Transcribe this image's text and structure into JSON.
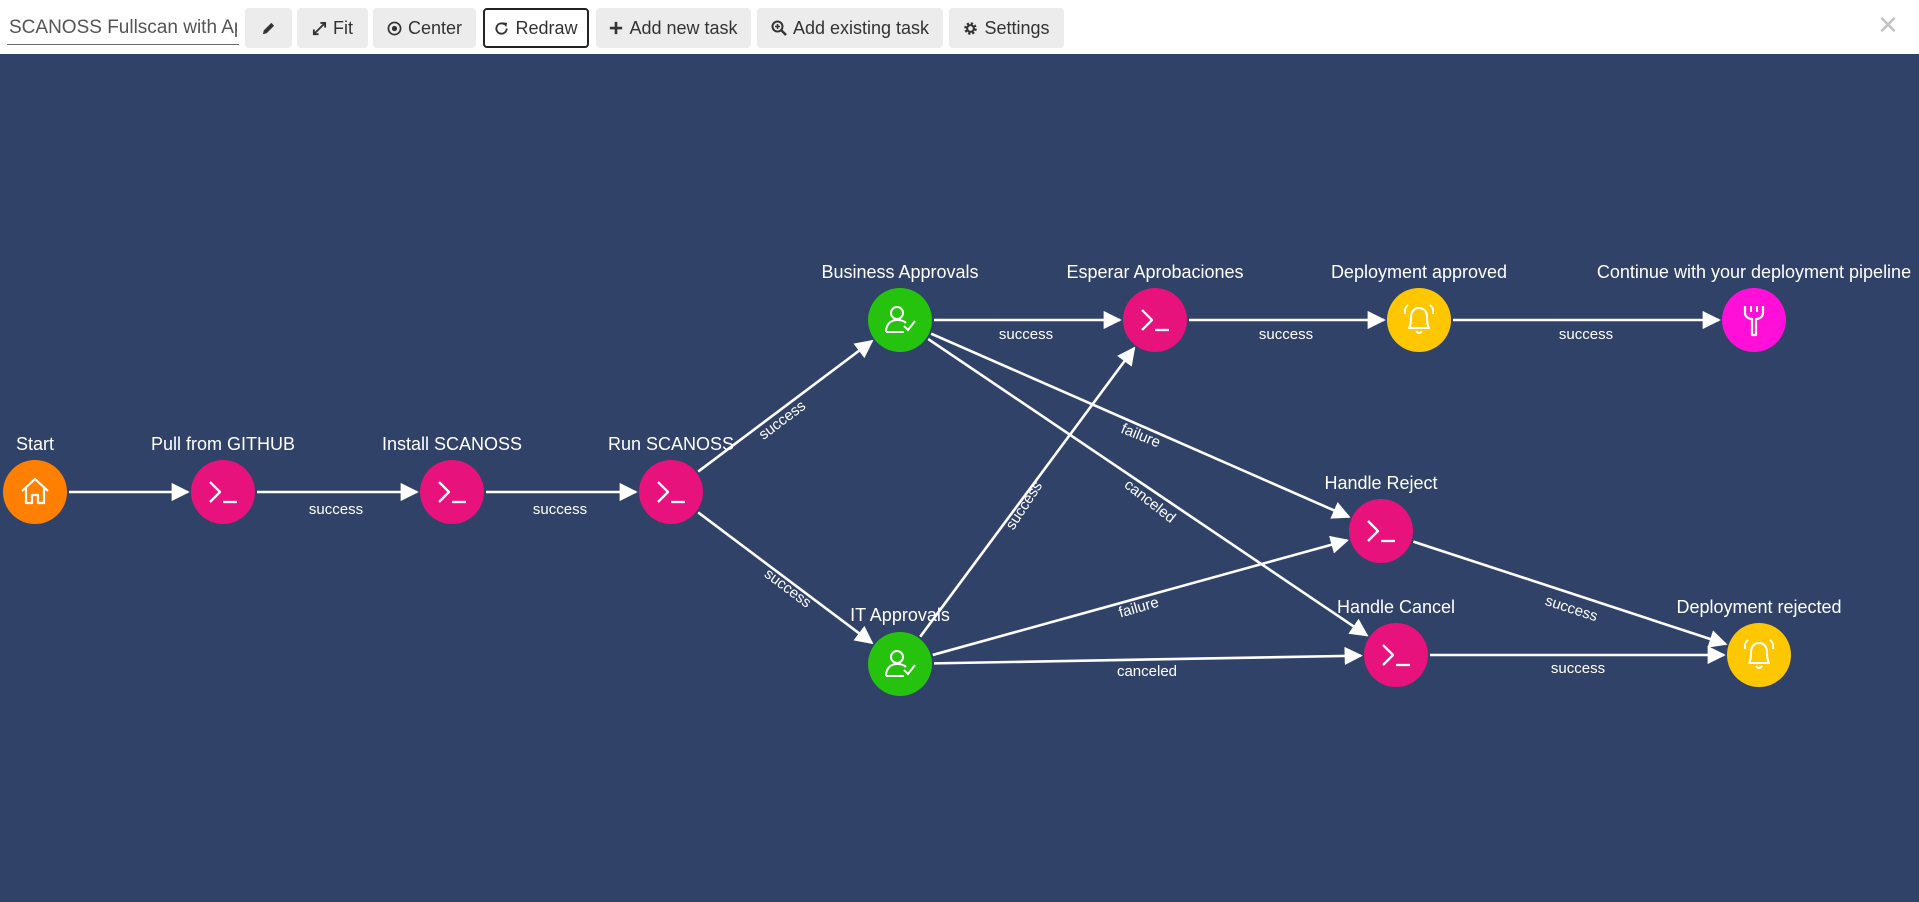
{
  "toolbar": {
    "title_value": "SCANOSS Fullscan with Approvals",
    "buttons": [
      {
        "label": "",
        "icon": "pencil-icon"
      },
      {
        "label": "Fit",
        "icon": "expand-icon"
      },
      {
        "label": "Center",
        "icon": "target-icon"
      },
      {
        "label": "Redraw",
        "icon": "redraw-icon"
      },
      {
        "label": "Add new task",
        "icon": "plus-icon"
      },
      {
        "label": "Add existing task",
        "icon": "search-plus-icon"
      },
      {
        "label": "Settings",
        "icon": "gear-icon"
      }
    ],
    "close_icon": "close-icon"
  },
  "colors": {
    "canvas": "#314269",
    "start": "#ff8000",
    "task": "#e8127c",
    "approval": "#25c20e",
    "notification": "#ffc700",
    "pipeline": "#ff0fd8",
    "edge": "#ffffff"
  },
  "nodes": [
    {
      "id": "start",
      "title": "Start",
      "kind": "start",
      "icon": "home-icon"
    },
    {
      "id": "pull",
      "title": "Pull from GITHUB",
      "kind": "task",
      "icon": "terminal-icon"
    },
    {
      "id": "install",
      "title": "Install SCANOSS",
      "kind": "task",
      "icon": "terminal-icon"
    },
    {
      "id": "run",
      "title": "Run SCANOSS",
      "kind": "task",
      "icon": "terminal-icon"
    },
    {
      "id": "biz",
      "title": "Business Approvals",
      "kind": "approval",
      "icon": "user-check-icon"
    },
    {
      "id": "it",
      "title": "IT Approvals",
      "kind": "approval",
      "icon": "user-check-icon"
    },
    {
      "id": "esperar",
      "title": "Esperar Aprobaciones",
      "kind": "task",
      "icon": "terminal-icon"
    },
    {
      "id": "deployok",
      "title": "Deployment approved",
      "kind": "notification",
      "icon": "bell-icon"
    },
    {
      "id": "continue",
      "title": "Continue with your deployment pipeline",
      "kind": "pipeline",
      "icon": "wrench-icon"
    },
    {
      "id": "reject",
      "title": "Handle Reject",
      "kind": "task",
      "icon": "terminal-icon"
    },
    {
      "id": "cancel",
      "title": "Handle Cancel",
      "kind": "task",
      "icon": "terminal-icon"
    },
    {
      "id": "deployrej",
      "title": "Deployment rejected",
      "kind": "notification",
      "icon": "bell-icon"
    }
  ],
  "edges": [
    {
      "from": "start",
      "to": "pull",
      "label": ""
    },
    {
      "from": "pull",
      "to": "install",
      "label": "success"
    },
    {
      "from": "install",
      "to": "run",
      "label": "success"
    },
    {
      "from": "run",
      "to": "biz",
      "label": "success"
    },
    {
      "from": "run",
      "to": "it",
      "label": "success"
    },
    {
      "from": "biz",
      "to": "esperar",
      "label": "success"
    },
    {
      "from": "biz",
      "to": "reject",
      "label": "failure"
    },
    {
      "from": "biz",
      "to": "cancel",
      "label": "canceled"
    },
    {
      "from": "it",
      "to": "esperar",
      "label": "success"
    },
    {
      "from": "it",
      "to": "reject",
      "label": "failure"
    },
    {
      "from": "it",
      "to": "cancel",
      "label": "canceled"
    },
    {
      "from": "esperar",
      "to": "deployok",
      "label": "success"
    },
    {
      "from": "deployok",
      "to": "continue",
      "label": "success"
    },
    {
      "from": "reject",
      "to": "deployrej",
      "label": "success"
    },
    {
      "from": "cancel",
      "to": "deployrej",
      "label": "success"
    }
  ]
}
